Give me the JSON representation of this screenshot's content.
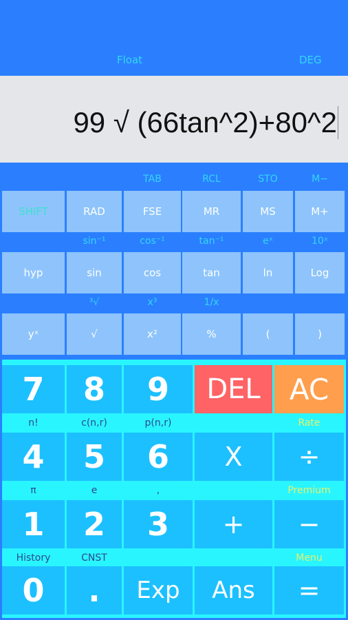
{
  "header": {
    "mode_float": "Float",
    "mode_angle": "DEG"
  },
  "display": {
    "expression": "99 √ (66tan^2)+80^2"
  },
  "scientific": {
    "row1_labels": [
      "",
      "",
      "TAB",
      "RCL",
      "STO",
      "M−"
    ],
    "row1_buttons": [
      "SHIFT",
      "RAD",
      "FSE",
      "MR",
      "MS",
      "M+"
    ],
    "row2_labels": [
      "",
      "sin⁻¹",
      "cos⁻¹",
      "tan⁻¹",
      "eˣ",
      "10ˣ"
    ],
    "row2_buttons": [
      "hyp",
      "sin",
      "cos",
      "tan",
      "ln",
      "Log"
    ],
    "row3_labels": [
      "",
      "³√",
      "x³",
      "1/x",
      "",
      ""
    ],
    "row3_buttons": [
      "yˣ",
      "√",
      "x²",
      "%",
      "(",
      ")"
    ]
  },
  "keypad": {
    "row1_buttons": [
      "7",
      "8",
      "9",
      "DEL",
      "AC"
    ],
    "row1_labels": [
      "n!",
      "c(n,r)",
      "p(n,r)",
      "",
      "Rate"
    ],
    "row2_buttons": [
      "4",
      "5",
      "6",
      "X",
      "÷"
    ],
    "row2_labels": [
      "π",
      "e",
      ",",
      "",
      "Premium"
    ],
    "row3_buttons": [
      "1",
      "2",
      "3",
      "+",
      "−"
    ],
    "row3_labels": [
      "History",
      "CNST",
      "",
      "",
      "Menu"
    ],
    "row4_buttons": [
      "0",
      ".",
      "Exp",
      "Ans",
      "="
    ]
  },
  "colors": {
    "primary_blue": "#2B7FFF",
    "sci_button": "#8EC4FB",
    "label_cyan": "#33D6F5",
    "pad_background": "#29F5FF",
    "num_button": "#1CC0FF",
    "del_button": "#FF6366",
    "ac_button": "#FF9F4D",
    "shift_text": "#3EE0D0",
    "promo_label": "#E6F26B"
  }
}
